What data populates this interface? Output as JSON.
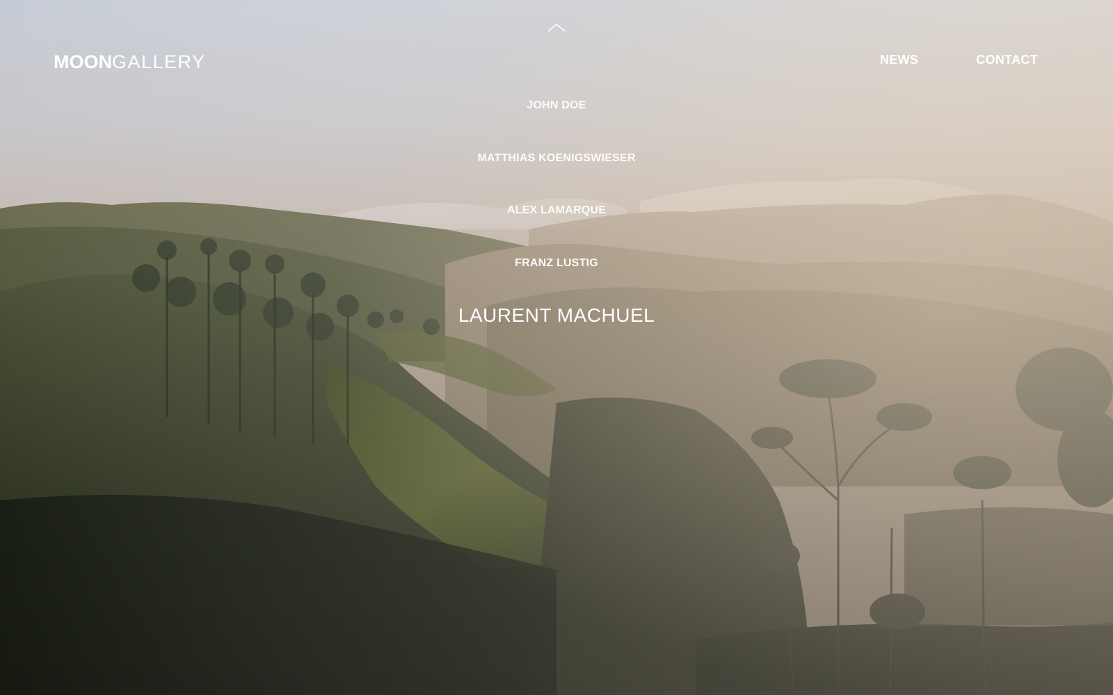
{
  "header": {
    "logo": {
      "part_bold": "MOON",
      "part_light": "GALLERY"
    },
    "nav": [
      {
        "label": "NEWS"
      },
      {
        "label": "CONTACT"
      }
    ],
    "scroll_up_icon": "chevron-up-icon"
  },
  "artists": {
    "items": [
      {
        "label": "JOHN DOE"
      },
      {
        "label": "MATTHIAS KOENIGSWIESER"
      },
      {
        "label": "ALEX LAMARQUE"
      },
      {
        "label": "FRANZ LUSTIG"
      },
      {
        "label": "LAURENT MACHUEL"
      }
    ],
    "active_label": "LAURENT MACHUEL"
  },
  "colors": {
    "text": "#ffffff",
    "sky_top": "#c9cdd4",
    "hills_dark": "#2a2e22"
  }
}
